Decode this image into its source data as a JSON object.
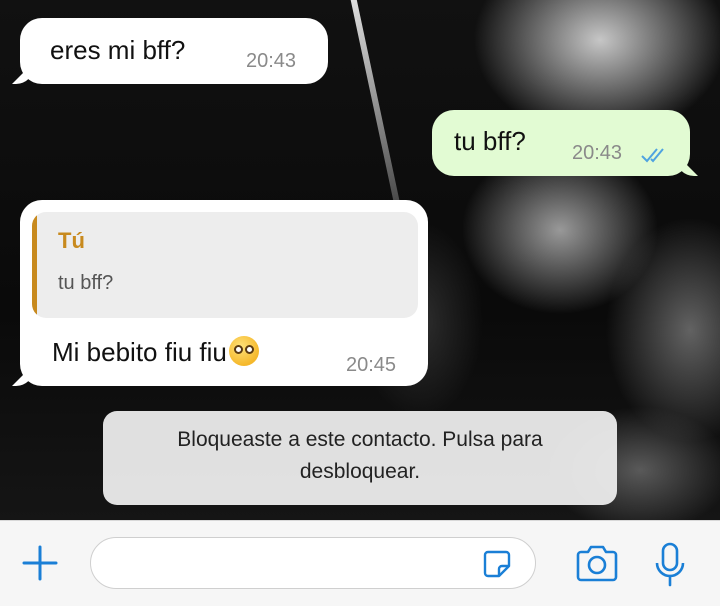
{
  "messages": [
    {
      "direction": "incoming",
      "text": "eres mi bff?",
      "time": "20:43"
    },
    {
      "direction": "outgoing",
      "text": "tu bff?",
      "time": "20:43",
      "status": "read-double-check-icon"
    },
    {
      "direction": "incoming",
      "quote": {
        "author": "Tú",
        "text": "tu bff?"
      },
      "text": "Mi bebito fiu fiu",
      "emoji": "pleading-face-emoji",
      "time": "20:45"
    }
  ],
  "system_notice": "Bloqueaste a este contacto. Pulsa para desbloquear.",
  "input_bar": {
    "placeholder": "",
    "icons": [
      "plus-icon",
      "sticker-icon",
      "camera-icon",
      "microphone-icon"
    ]
  },
  "colors": {
    "incoming_bubble": "#ffffff",
    "outgoing_bubble": "#e2fbd3",
    "accent": "#1a7fd6",
    "quote_author": "#c88a1e",
    "read_ticks": "#4fa3e0"
  }
}
